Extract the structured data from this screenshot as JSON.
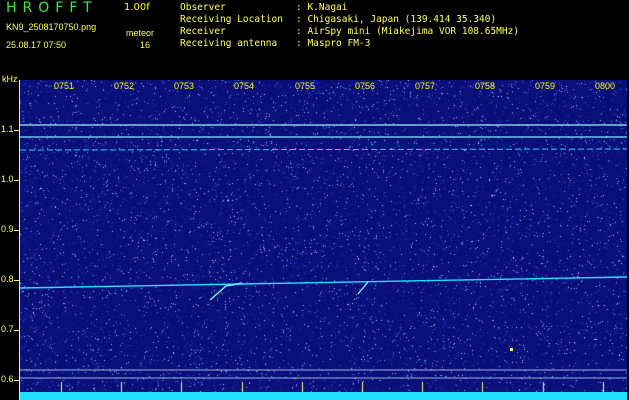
{
  "header": {
    "title": "HROFFT",
    "version": "1.00f",
    "filename": "KN9_2508170750.png",
    "datetime": "25.08.17 07:50",
    "meteor_label": "meteor",
    "meteor_count": "16"
  },
  "observer_info": {
    "observer_label": "Observer",
    "observer_value": ": K.Nagai",
    "location_label": "Receiving Location",
    "location_value": ": Chigasaki, Japan (139.414 35.340)",
    "receiver_label": "Receiver",
    "receiver_value": ": AirSpy mini (Miakejima VOR 108.65MHz)",
    "antenna_label": "Receiving antenna",
    "antenna_value": ": Maspro FM-3"
  },
  "axes": {
    "y_unit": "kHz",
    "y_ticks": [
      "1.1",
      "1.0",
      "0.9",
      "0.8",
      "0.7",
      "0.6"
    ],
    "x_ticks": [
      "0751",
      "0752",
      "0753",
      "0754",
      "0755",
      "0756",
      "0757",
      "0758",
      "0759",
      "0800"
    ]
  },
  "colors": {
    "background": "#0a0f7a",
    "signal": "#22e0ff",
    "text": "#ffff66",
    "title": "#33ee33"
  }
}
